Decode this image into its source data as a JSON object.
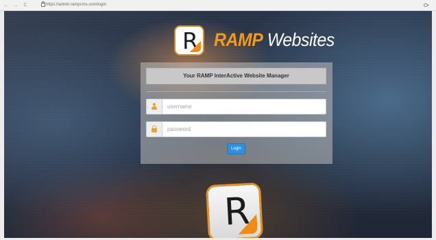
{
  "browser": {
    "back_icon": "←",
    "forward_icon": "→",
    "reload_icon": "C",
    "url": "https://admin.rampcms.com/login"
  },
  "logo": {
    "brand": "RAMP",
    "product": "Websites",
    "mark_letter": "R",
    "colors": {
      "brand": "#f39a1c",
      "product": "#ffffff"
    }
  },
  "login": {
    "header": "Your RAMP InterActive Website Manager",
    "username": {
      "value": "",
      "placeholder": "username",
      "icon": "user-icon"
    },
    "password": {
      "value": "",
      "placeholder": "password",
      "icon": "lock-icon"
    },
    "button_label": "Login",
    "accent_color": "#2f90e0"
  },
  "background": {
    "jersey_letter": "R"
  }
}
